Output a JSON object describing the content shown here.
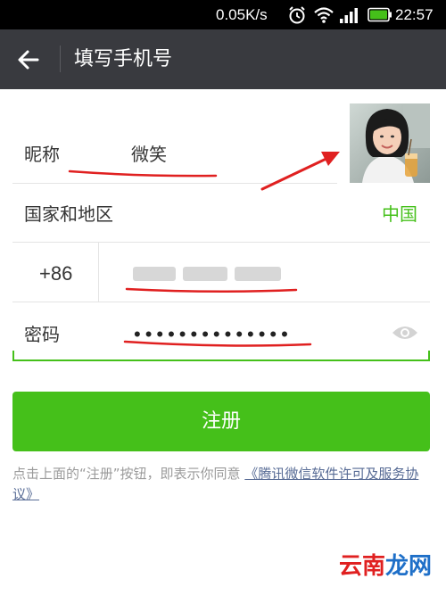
{
  "status_bar": {
    "speed": "0.05K/s",
    "time": "22:57",
    "icons": [
      "alarm-clock-icon",
      "wifi-icon",
      "signal-icon",
      "battery-icon"
    ]
  },
  "header": {
    "title": "填写手机号",
    "back_icon": "arrow-left-icon"
  },
  "form": {
    "nickname": {
      "label": "昵称",
      "value": "微笑"
    },
    "country": {
      "label": "国家和地区",
      "value": "中国"
    },
    "phone": {
      "code": "+86",
      "value_note": "blurred"
    },
    "password": {
      "label": "密码",
      "value": "••••••••••••••",
      "toggle_icon": "eye-icon"
    }
  },
  "register_button": {
    "label": "注册"
  },
  "terms": {
    "text": "点击上面的“注册”按钮，即表示你同意",
    "link": "《腾讯微信软件许可及服务协议》"
  },
  "watermark": {
    "part1": "云南",
    "part2": "龙网"
  },
  "colors": {
    "accent": "#45c01a",
    "header_bg": "#393a3f",
    "annotation": "#e02020",
    "link": "#576b95"
  }
}
